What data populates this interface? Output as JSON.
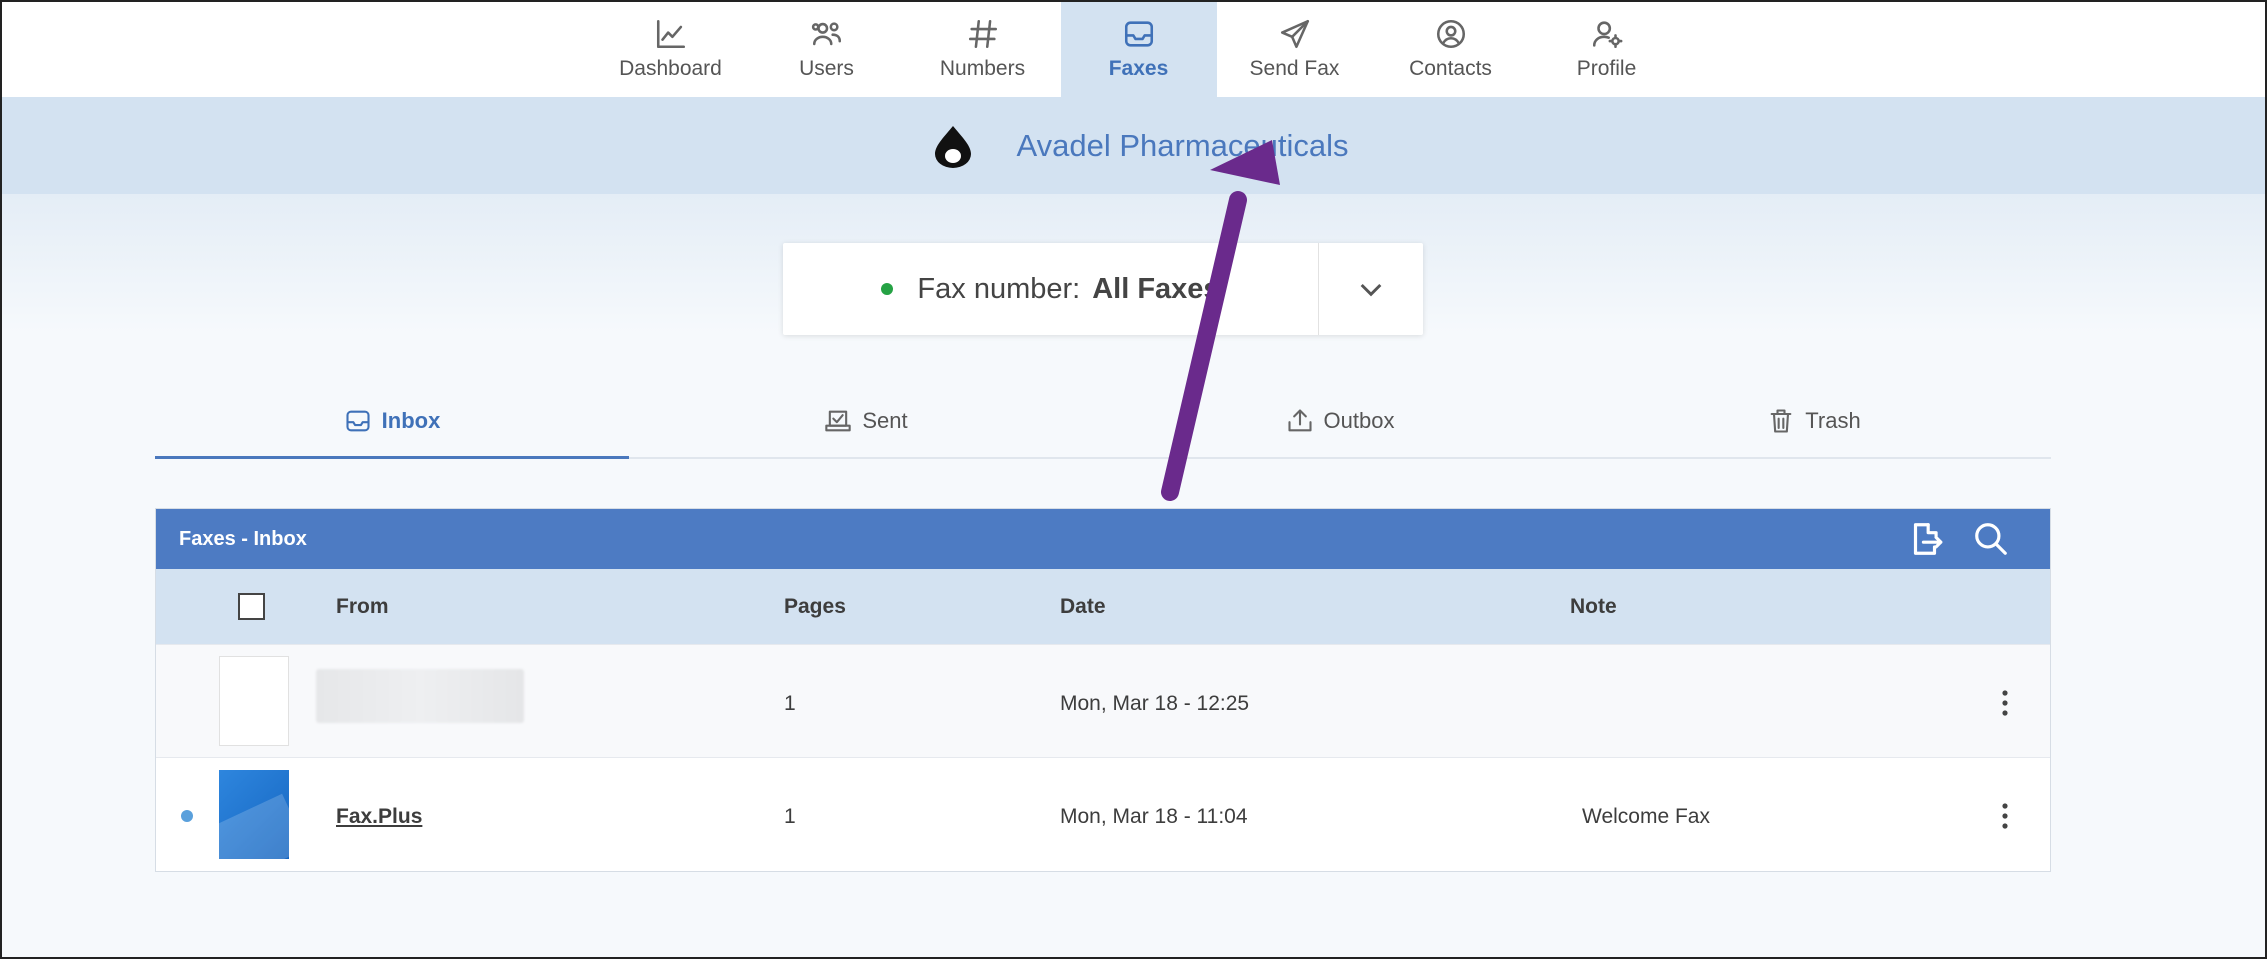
{
  "nav": {
    "items": [
      {
        "label": "Dashboard",
        "icon": "chart-line-icon"
      },
      {
        "label": "Users",
        "icon": "users-icon"
      },
      {
        "label": "Numbers",
        "icon": "hash-icon"
      },
      {
        "label": "Faxes",
        "icon": "inbox-icon",
        "active": true
      },
      {
        "label": "Send Fax",
        "icon": "paper-plane-icon"
      },
      {
        "label": "Contacts",
        "icon": "contact-icon"
      },
      {
        "label": "Profile",
        "icon": "user-gear-icon"
      }
    ]
  },
  "org": {
    "name": "Avadel Pharmaceuticals"
  },
  "fax_selector": {
    "label": "Fax number:",
    "value": "All Faxes"
  },
  "subtabs": [
    {
      "label": "Inbox",
      "icon": "inbox-icon",
      "active": true
    },
    {
      "label": "Sent",
      "icon": "sent-tray-icon"
    },
    {
      "label": "Outbox",
      "icon": "upload-icon"
    },
    {
      "label": "Trash",
      "icon": "trash-icon"
    }
  ],
  "panel": {
    "title": "Faxes - Inbox",
    "actions": [
      "export-icon",
      "search-icon"
    ]
  },
  "table": {
    "columns": {
      "from": "From",
      "pages": "Pages",
      "date": "Date",
      "note": "Note"
    },
    "rows": [
      {
        "from": "",
        "pages": "1",
        "date": "Mon, Mar 18 - 12:25",
        "note": "",
        "unread": false
      },
      {
        "from": "Fax.Plus",
        "pages": "1",
        "date": "Mon, Mar 18 - 11:04",
        "note": "Welcome Fax",
        "unread": true
      }
    ]
  },
  "colors": {
    "accent": "#4d7bc3",
    "banner": "#d3e2f1",
    "status": "#25a244",
    "arrow": "#6a2a8c"
  }
}
